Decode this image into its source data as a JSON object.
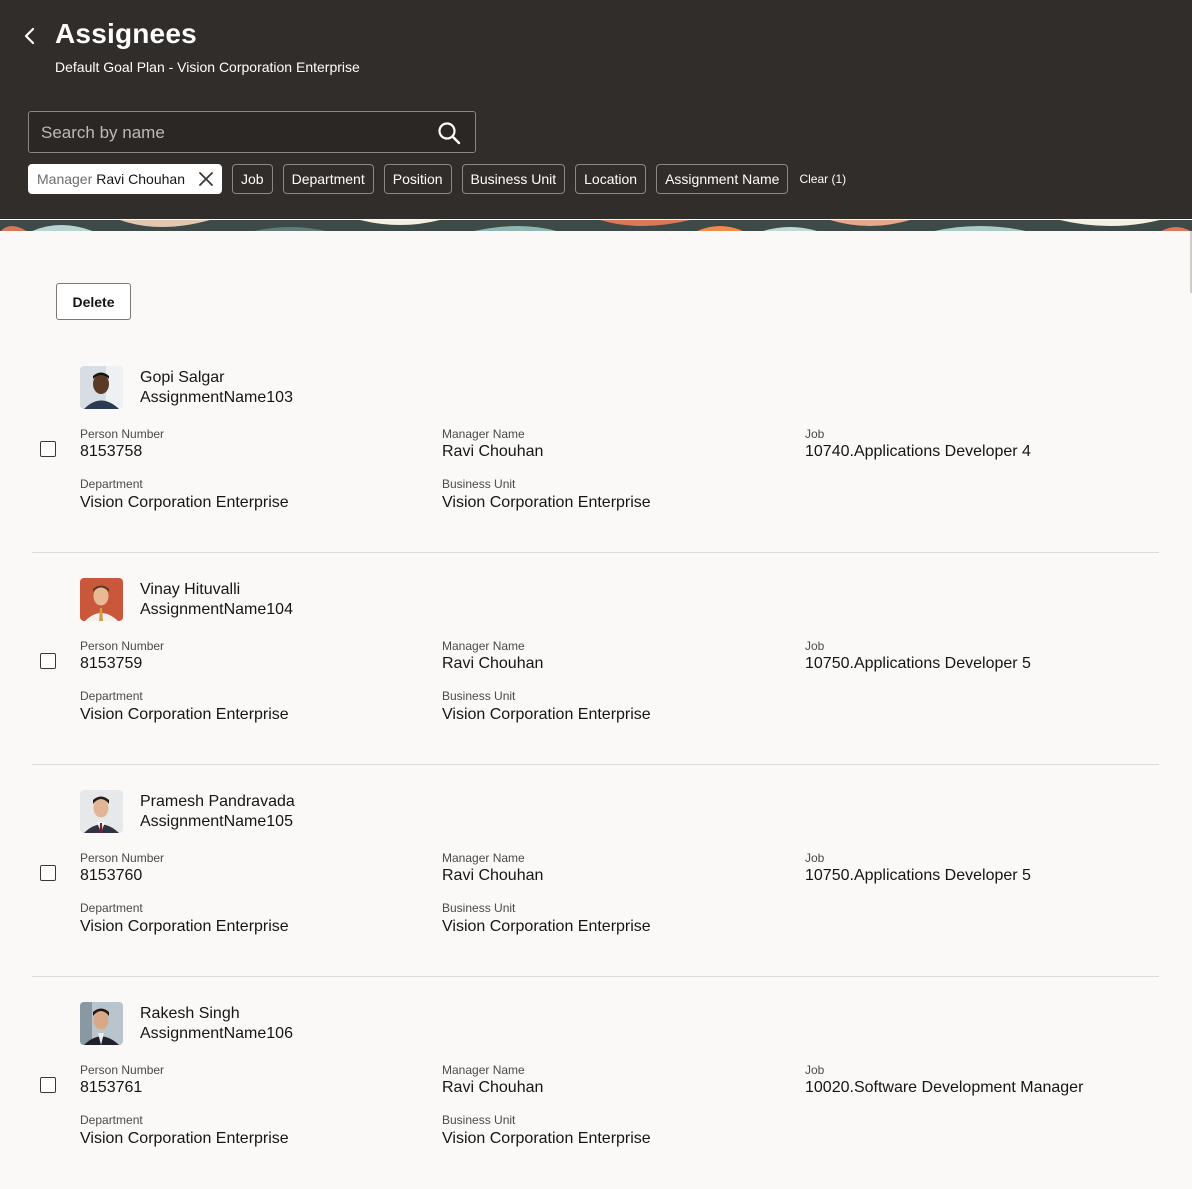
{
  "header": {
    "title": "Assignees",
    "subtitle": "Default Goal Plan - Vision Corporation Enterprise",
    "search_placeholder": "Search by name",
    "filters": {
      "manager_label": "Manager",
      "manager_value": "Ravi Chouhan",
      "chips": [
        "Job",
        "Department",
        "Position",
        "Business Unit",
        "Location",
        "Assignment Name"
      ],
      "clear_label": "Clear (1)"
    }
  },
  "actions": {
    "delete_label": "Delete"
  },
  "labels": {
    "person_number": "Person Number",
    "manager_name": "Manager Name",
    "job": "Job",
    "department": "Department",
    "business_unit": "Business Unit"
  },
  "assignees": [
    {
      "name": "Gopi Salgar",
      "assignment": "AssignmentName103",
      "person_number": "8153758",
      "manager_name": "Ravi Chouhan",
      "job": "10740.Applications Developer 4",
      "department": "Vision Corporation Enterprise",
      "business_unit": "Vision Corporation Enterprise"
    },
    {
      "name": "Vinay Hituvalli",
      "assignment": "AssignmentName104",
      "person_number": "8153759",
      "manager_name": "Ravi Chouhan",
      "job": "10750.Applications Developer 5",
      "department": "Vision Corporation Enterprise",
      "business_unit": "Vision Corporation Enterprise"
    },
    {
      "name": "Pramesh Pandravada",
      "assignment": "AssignmentName105",
      "person_number": "8153760",
      "manager_name": "Ravi Chouhan",
      "job": "10750.Applications Developer 5",
      "department": "Vision Corporation Enterprise",
      "business_unit": "Vision Corporation Enterprise"
    },
    {
      "name": "Rakesh Singh",
      "assignment": "AssignmentName106",
      "person_number": "8153761",
      "manager_name": "Ravi Chouhan",
      "job": "10020.Software Development Manager",
      "department": "Vision Corporation Enterprise",
      "business_unit": "Vision Corporation Enterprise"
    }
  ],
  "colors": {
    "header_bg": "#312d2a",
    "page_bg": "#faf9f8",
    "text": "#161513"
  }
}
